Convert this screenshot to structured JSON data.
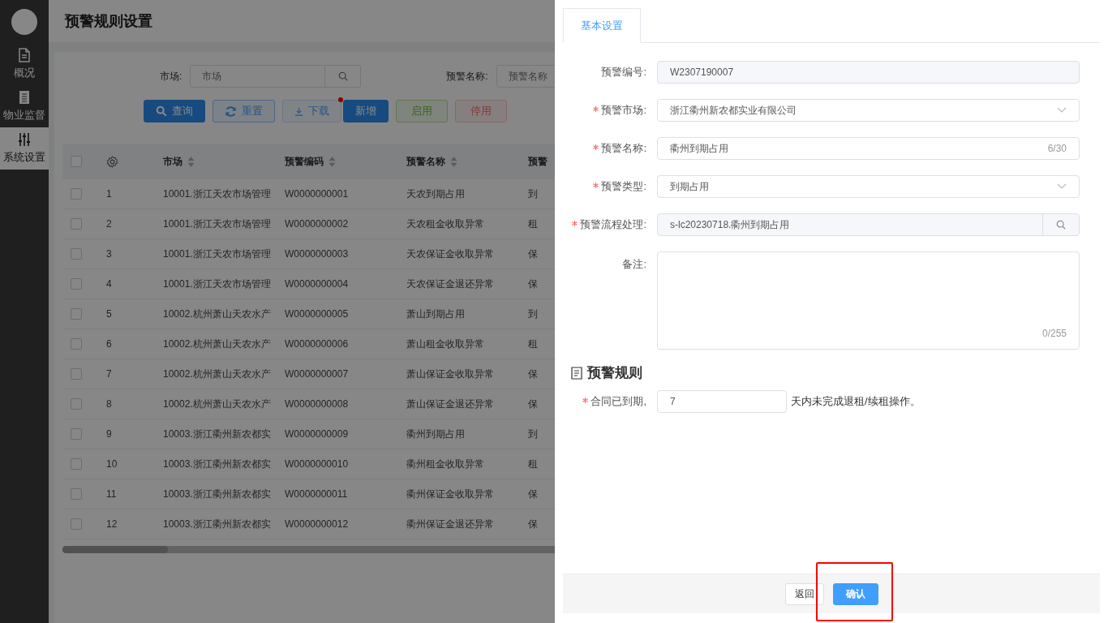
{
  "sidebar": {
    "items": [
      {
        "label": "概况",
        "selected": false
      },
      {
        "label": "物业监督",
        "selected": false
      },
      {
        "label": "系统设置",
        "selected": true
      }
    ]
  },
  "page_title": "预警规则设置",
  "filters": [
    {
      "label": "市场:",
      "placeholder": "市场"
    },
    {
      "label": "预警名称:",
      "placeholder": "预警名称"
    }
  ],
  "toolbar": [
    {
      "label": "查询",
      "kind": "search",
      "dot": false
    },
    {
      "label": "重置",
      "kind": "reset",
      "dot": false
    },
    {
      "label": "下载",
      "kind": "download",
      "dot": true
    },
    {
      "label": "新增",
      "kind": "primary",
      "dot": false
    },
    {
      "label": "启用",
      "kind": "success",
      "dot": false
    },
    {
      "label": "停用",
      "kind": "danger",
      "dot": false
    }
  ],
  "table": {
    "all_checked": false,
    "columns": [
      {
        "label": "市场",
        "sortable": true
      },
      {
        "label": "预警编码",
        "sortable": true
      },
      {
        "label": "预警名称",
        "sortable": true
      },
      {
        "label": "预警",
        "sortable": false
      }
    ],
    "rows": [
      {
        "checked": false,
        "index": "1",
        "market": "10001.浙江天农市场管理",
        "code": "W0000000001",
        "name": "天农到期占用",
        "column_5": "到"
      },
      {
        "checked": false,
        "index": "2",
        "market": "10001.浙江天农市场管理",
        "code": "W0000000002",
        "name": "天农租金收取异常",
        "column_5": "租"
      },
      {
        "checked": false,
        "index": "3",
        "market": "10001.浙江天农市场管理",
        "code": "W0000000003",
        "name": "天农保证金收取异常",
        "column_5": "保"
      },
      {
        "checked": false,
        "index": "4",
        "market": "10001.浙江天农市场管理",
        "code": "W0000000004",
        "name": "天农保证金退还异常",
        "column_5": "保"
      },
      {
        "checked": false,
        "index": "5",
        "market": "10002.杭州萧山天农水产",
        "code": "W0000000005",
        "name": "萧山到期占用",
        "column_5": "到"
      },
      {
        "checked": false,
        "index": "6",
        "market": "10002.杭州萧山天农水产",
        "code": "W0000000006",
        "name": "萧山租金收取异常",
        "column_5": "租"
      },
      {
        "checked": false,
        "index": "7",
        "market": "10002.杭州萧山天农水产",
        "code": "W0000000007",
        "name": "萧山保证金收取异常",
        "column_5": "保"
      },
      {
        "checked": false,
        "index": "8",
        "market": "10002.杭州萧山天农水产",
        "code": "W0000000008",
        "name": "萧山保证金退还异常",
        "column_5": "保"
      },
      {
        "checked": false,
        "index": "9",
        "market": "10003.浙江衢州新农都实",
        "code": "W0000000009",
        "name": "衢州到期占用",
        "column_5": "到"
      },
      {
        "checked": false,
        "index": "10",
        "market": "10003.浙江衢州新农都实",
        "code": "W0000000010",
        "name": "衢州租金收取异常",
        "column_5": "租"
      },
      {
        "checked": false,
        "index": "11",
        "market": "10003.浙江衢州新农都实",
        "code": "W0000000011",
        "name": "衢州保证金收取异常",
        "column_5": "保"
      },
      {
        "checked": false,
        "index": "12",
        "market": "10003.浙江衢州新农都实",
        "code": "W0000000012",
        "name": "衢州保证金退还异常",
        "column_5": "保"
      }
    ]
  },
  "drawer": {
    "tabs": [
      {
        "label": "基本设置",
        "selected": true
      }
    ],
    "fields": [
      {
        "label": "预警编号:",
        "required": false,
        "kind": "readonly",
        "value": "W2307190007"
      },
      {
        "label": "预警市场:",
        "required": true,
        "kind": "select",
        "value": "浙江衢州新农都实业有限公司"
      },
      {
        "label": "预警名称:",
        "required": true,
        "kind": "text",
        "value": "衢州到期占用",
        "counter": "6/30"
      },
      {
        "label": "预警类型:",
        "required": true,
        "kind": "select",
        "value": "到期占用"
      },
      {
        "label": "预警流程处理:",
        "required": true,
        "kind": "lookup",
        "value": "s-lc20230718.衢州到期占用"
      },
      {
        "label": "备注:",
        "required": false,
        "kind": "textarea",
        "counter": "0/255"
      }
    ],
    "rule_section": {
      "title": "预警规则",
      "label": "合同已到期,",
      "required": true,
      "value": "7",
      "suffix": "天内未完成退租/续租操作。"
    },
    "footer": {
      "buttons": [
        {
          "label": "返回",
          "kind": "default"
        },
        {
          "label": "确认",
          "kind": "primary"
        }
      ]
    }
  }
}
